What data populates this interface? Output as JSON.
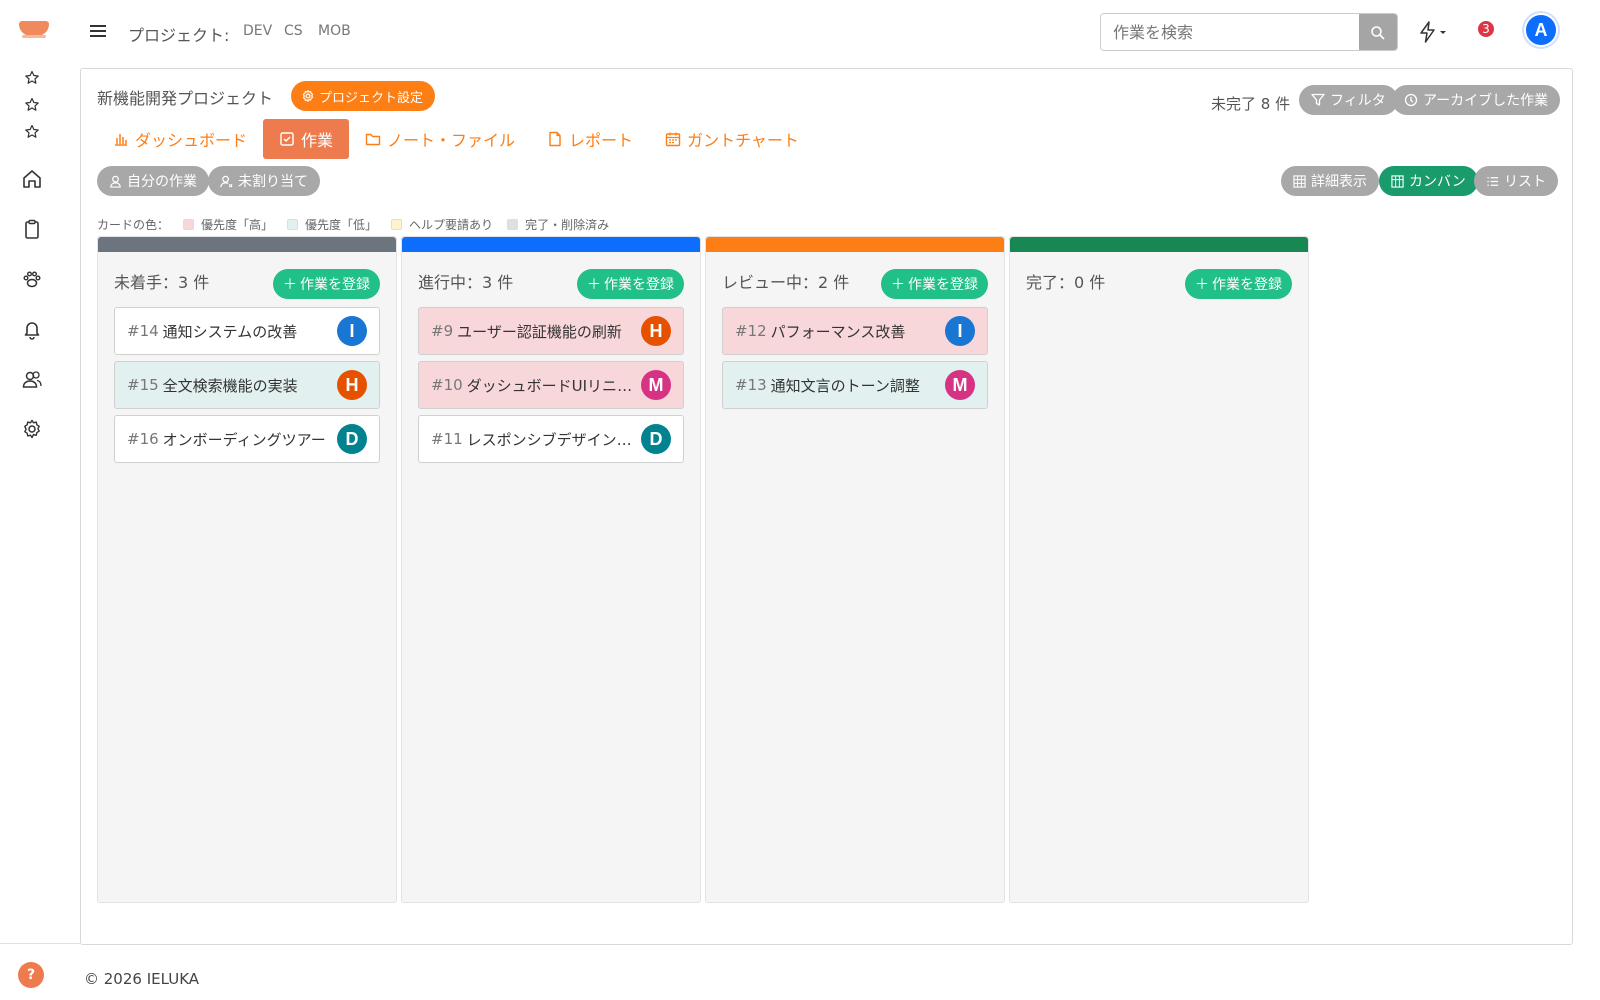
{
  "header": {
    "project_label": "プロジェクト:",
    "project_links": [
      "DEV",
      "CS",
      "MOB"
    ],
    "search_placeholder": "作業を検索",
    "notification_count": "3",
    "user_initial": "A"
  },
  "project": {
    "title": "新機能開発プロジェクト",
    "settings_label": "プロジェクト設定",
    "incomplete_text": "未完了 8 件",
    "filter_label": "フィルタ",
    "archive_label": "アーカイブした作業"
  },
  "tabs": [
    {
      "label": "ダッシュボード",
      "icon": "bar-chart-icon"
    },
    {
      "label": "作業",
      "icon": "check-square-icon",
      "active": true
    },
    {
      "label": "ノート・ファイル",
      "icon": "folder-icon"
    },
    {
      "label": "レポート",
      "icon": "document-icon"
    },
    {
      "label": "ガントチャート",
      "icon": "calendar-icon"
    }
  ],
  "filters": {
    "my_tasks": "自分の作業",
    "unassigned": "未割り当て"
  },
  "views": {
    "detail": "詳細表示",
    "kanban": "カンバン",
    "list": "リスト"
  },
  "legend": {
    "label": "カードの色：",
    "items": [
      {
        "label": "優先度「高」",
        "color": "#f8d7da"
      },
      {
        "label": "優先度「低」",
        "color": "#e2f0ef"
      },
      {
        "label": "ヘルプ要請あり",
        "color": "#fff3cd"
      },
      {
        "label": "完了・削除済み",
        "color": "#e0e0e0"
      }
    ]
  },
  "columns": [
    {
      "title": "未着手：3 件",
      "color": "#6c757d",
      "add_label": "作業を登録",
      "cards": [
        {
          "num": "#14",
          "title": "通知システムの改善",
          "avatar": "I",
          "avatar_color": "#1976d2",
          "bg": "#ffffff"
        },
        {
          "num": "#15",
          "title": "全文検索機能の実装",
          "avatar": "H",
          "avatar_color": "#e65100",
          "bg": "#e2f0ef"
        },
        {
          "num": "#16",
          "title": "オンボーディングツアー",
          "avatar": "D",
          "avatar_color": "#00838f",
          "bg": "#ffffff"
        }
      ]
    },
    {
      "title": "進行中：3 件",
      "color": "#0d6efd",
      "add_label": "作業を登録",
      "cards": [
        {
          "num": "#9",
          "title": "ユーザー認証機能の刷新",
          "avatar": "H",
          "avatar_color": "#e65100",
          "bg": "#f8d7da"
        },
        {
          "num": "#10",
          "title": "ダッシュボードUIリニューアル",
          "avatar": "M",
          "avatar_color": "#d63384",
          "bg": "#f8d7da"
        },
        {
          "num": "#11",
          "title": "レスポンシブデザイン対応",
          "avatar": "D",
          "avatar_color": "#00838f",
          "bg": "#ffffff"
        }
      ]
    },
    {
      "title": "レビュー中：2 件",
      "color": "#fd7e14",
      "add_label": "作業を登録",
      "cards": [
        {
          "num": "#12",
          "title": "パフォーマンス改善",
          "avatar": "I",
          "avatar_color": "#1976d2",
          "bg": "#f8d7da"
        },
        {
          "num": "#13",
          "title": "通知文言のトーン調整",
          "avatar": "M",
          "avatar_color": "#d63384",
          "bg": "#e2f0ef"
        }
      ]
    },
    {
      "title": "完了：0 件",
      "color": "#198754",
      "add_label": "作業を登録",
      "cards": []
    }
  ],
  "footer": "© 2026 IELUKA"
}
